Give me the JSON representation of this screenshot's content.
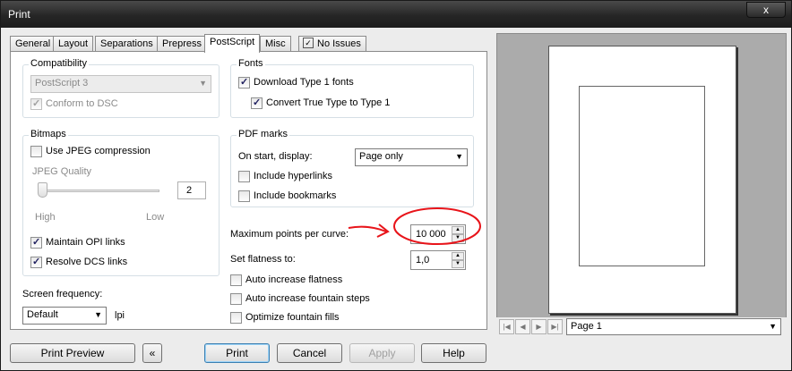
{
  "window": {
    "title": "Print",
    "close_glyph": "x"
  },
  "tabs": [
    "General",
    "Layout",
    "Separations",
    "Prepress",
    "PostScript",
    "Misc",
    "No Issues"
  ],
  "active_tab": "PostScript",
  "compatibility": {
    "label": "Compatibility",
    "level_value": "PostScript 3",
    "conform_label": "Conform to DSC",
    "conform_checked": true
  },
  "fonts": {
    "label": "Fonts",
    "download_label": "Download Type 1 fonts",
    "download_checked": true,
    "convert_label": "Convert True Type to Type 1",
    "convert_checked": true
  },
  "bitmaps": {
    "label": "Bitmaps",
    "jpeg_label": "Use JPEG compression",
    "jpeg_checked": false,
    "quality_label": "JPEG Quality",
    "quality_value": "2",
    "high_label": "High",
    "low_label": "Low",
    "opi_label": "Maintain OPI links",
    "opi_checked": true,
    "dcs_label": "Resolve DCS links",
    "dcs_checked": true
  },
  "pdf_marks": {
    "label": "PDF marks",
    "start_label": "On start, display:",
    "start_value": "Page only",
    "hyperlinks_label": "Include hyperlinks",
    "bookmarks_label": "Include bookmarks"
  },
  "curve": {
    "label": "Maximum points per curve:",
    "value": "10 000"
  },
  "flatness": {
    "label": "Set flatness to:",
    "value": "1,0"
  },
  "options": {
    "auto_flatness": "Auto increase flatness",
    "auto_fountain": "Auto increase fountain steps",
    "optimize_fountain": "Optimize fountain fills"
  },
  "screen": {
    "label": "Screen frequency:",
    "value": "Default",
    "unit": "lpi"
  },
  "preview_nav": {
    "page_value": "Page 1"
  },
  "buttons": {
    "print_preview": "Print Preview",
    "print": "Print",
    "cancel": "Cancel",
    "apply": "Apply",
    "help": "Help"
  },
  "colors": {
    "annotation": "#e8141a"
  }
}
